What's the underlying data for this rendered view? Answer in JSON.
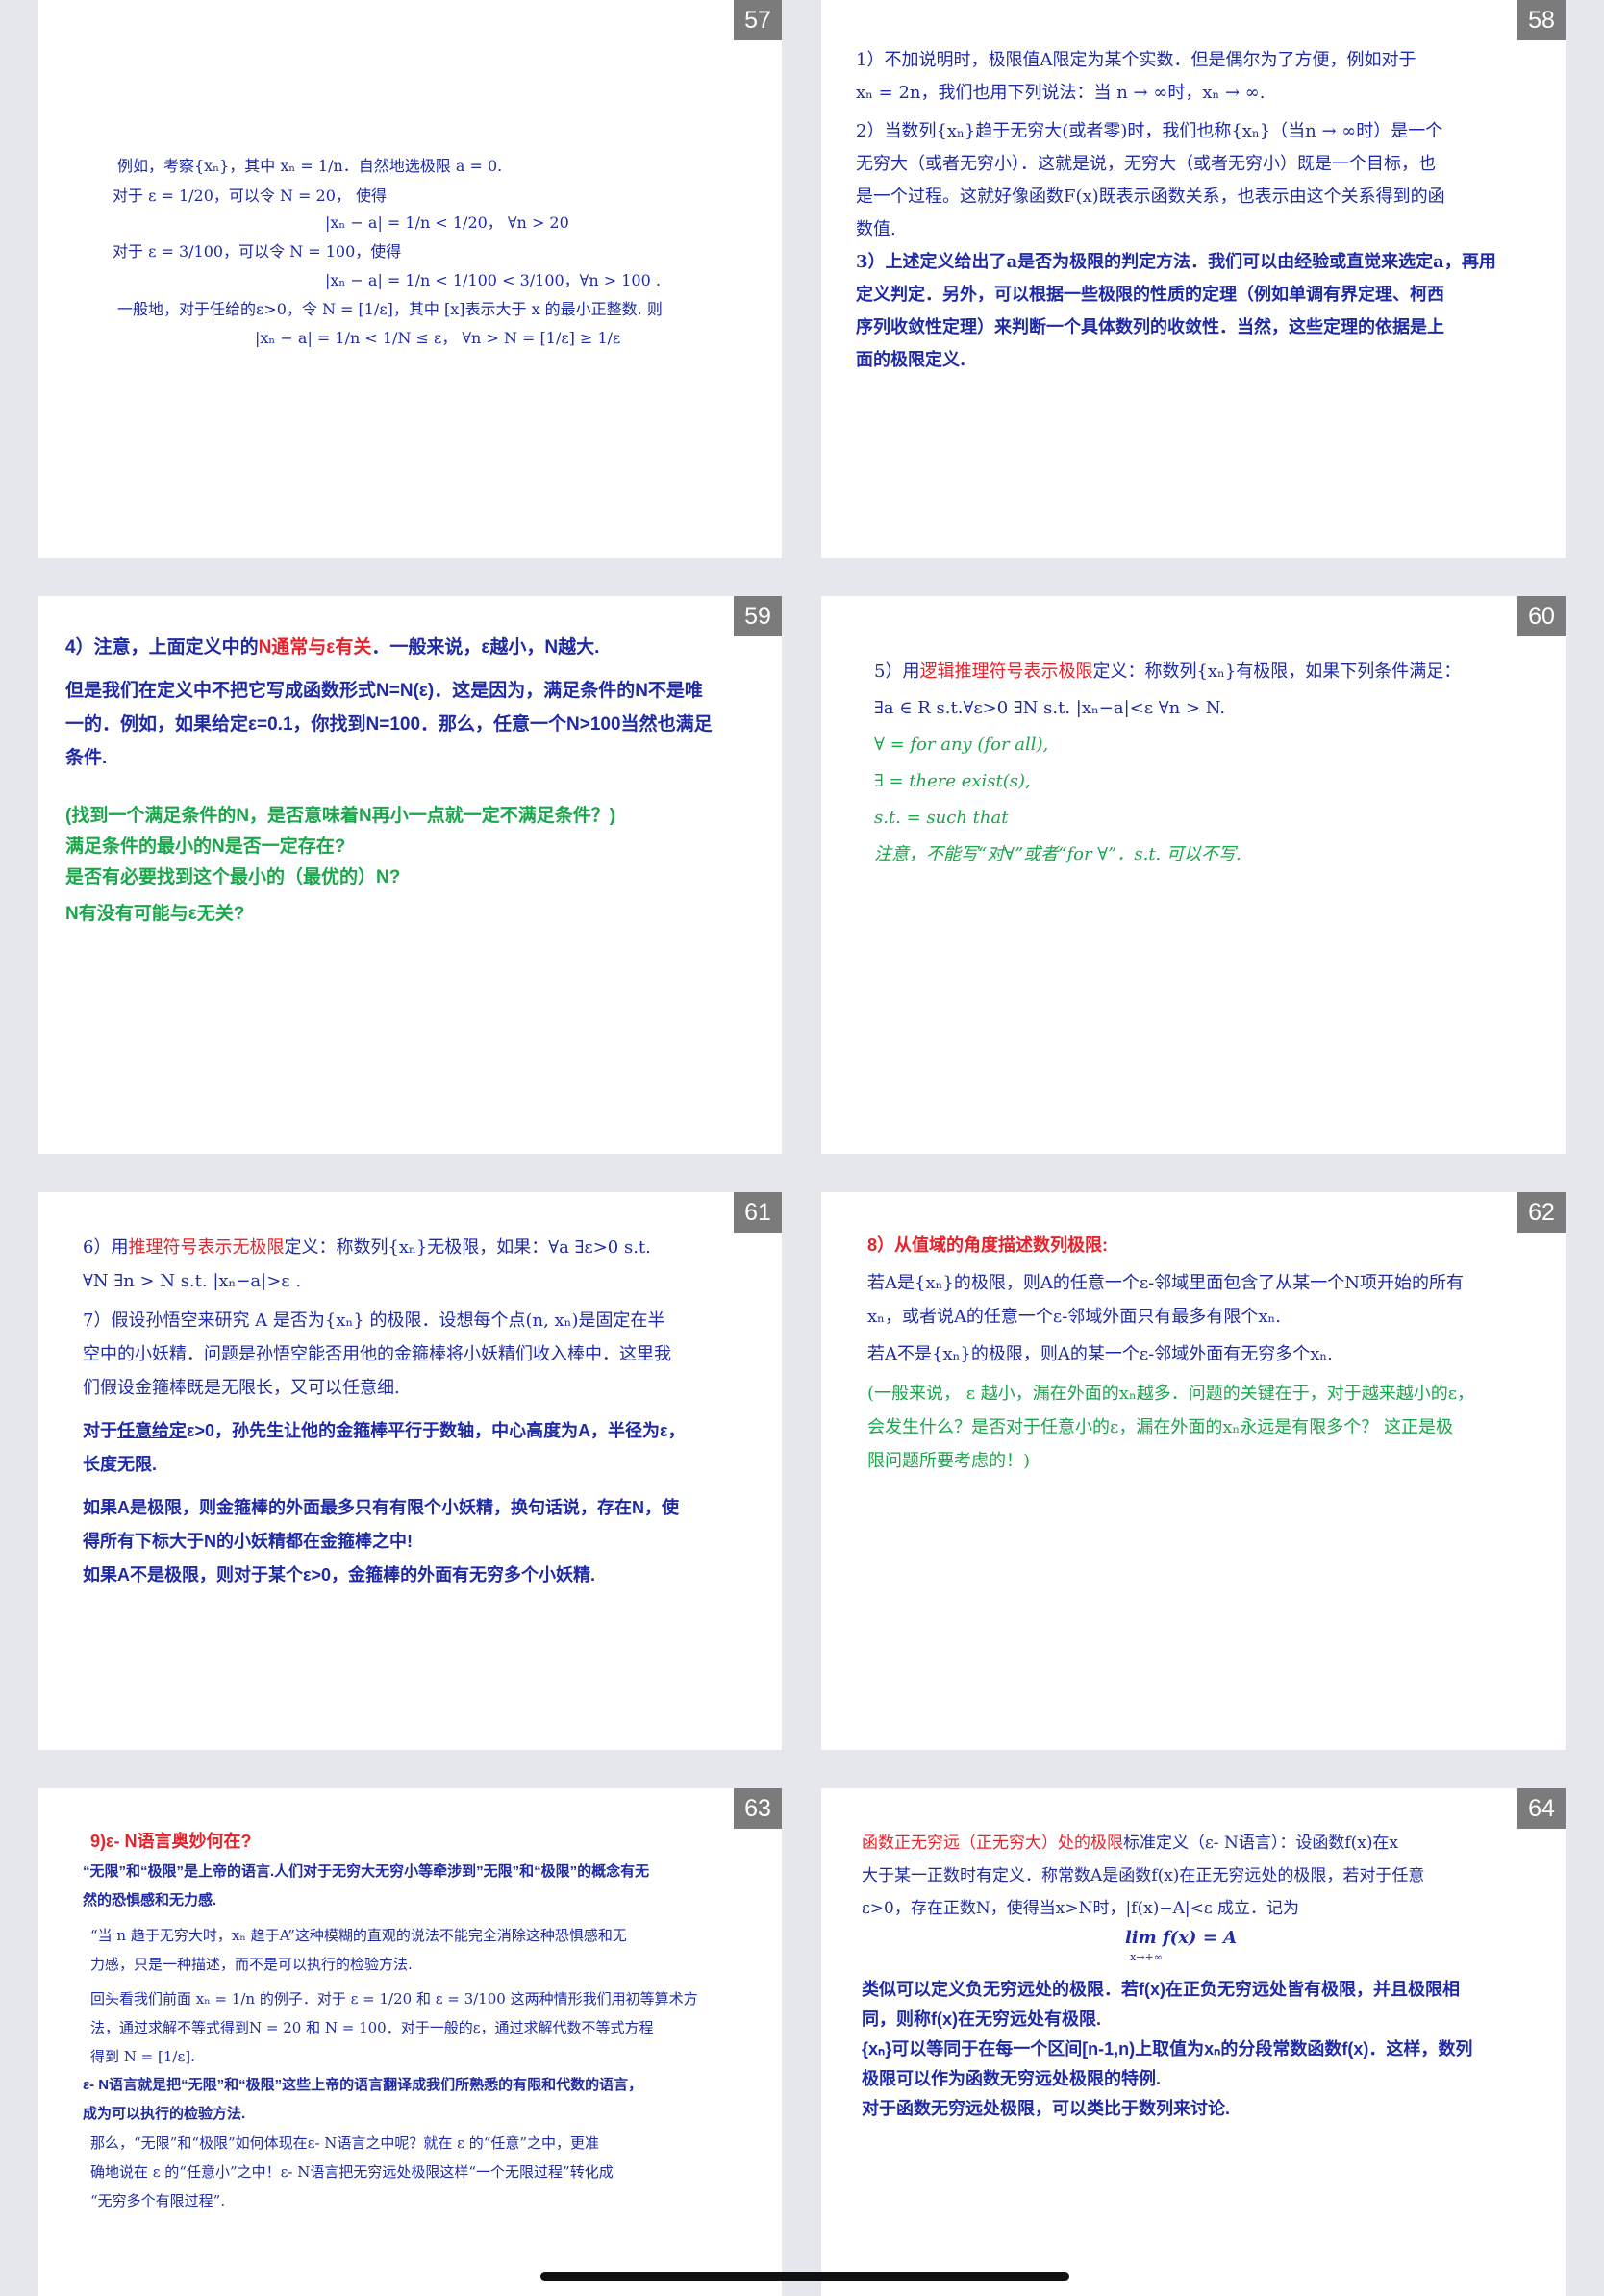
{
  "slides": [
    {
      "num": "57",
      "lines": [
        "例如，考察{xₙ}，其中 xₙ = 1/n．自然地选极限 a = 0.",
        "对于  ε = 1/20，可以令  N = 20，   使得",
        "|xₙ − a| = 1/n < 1/20，      ∀n > 20",
        "对于  ε = 3/100，可以令 N = 100，使得",
        "|xₙ − a| = 1/n < 1/100 < 3/100，∀n > 100 .",
        "一般地，对于任给的ε>0，令 N = [1/ε]，其中 [x]表示大于 x 的最小正整数. 则",
        "|xₙ − a| = 1/n < 1/N ≤ ε，      ∀n > N = [1/ε] ≥ 1/ε"
      ]
    },
    {
      "num": "58",
      "lines": [
        "1）不加说明时，极限值A限定为某个实数．但是偶尔为了方便，例如对于",
        "xₙ = 2n，我们也用下列说法：当  n → ∞时，xₙ → ∞.",
        "2）当数列{xₙ}趋于无穷大(或者零)时，我们也称{xₙ}（当n → ∞时）是一个",
        "无穷大（或者无穷小）．这就是说，无穷大（或者无穷小）既是一个目标，也",
        "是一个过程。这就好像函数F(x)既表示函数关系，也表示由这个关系得到的函",
        "数值.",
        "3）上述定义给出了a是否为极限的判定方法．我们可以由经验或直觉来选定a，再用",
        "定义判定．另外，可以根据一些极限的性质的定理（例如单调有界定理、柯西",
        "序列收敛性定理）来判断一个具体数列的收敛性．当然，这些定理的依据是上",
        "面的极限定义."
      ]
    },
    {
      "num": "59",
      "l1_a": "4）注意，上面定义中的",
      "l1_b": "N通常与ε有关",
      "l1_c": "．一般来说，ε越小，N越大.",
      "lines": [
        "但是我们在定义中不把它写成函数形式N=N(ε)．这是因为，满足条件的N不是唯",
        "一的．例如，如果给定ε=0.1，你找到N=100．那么，任意一个N>100当然也满足",
        "条件."
      ],
      "green": [
        "(找到一个满足条件的N，是否意味着N再小一点就一定不满足条件？)",
        "满足条件的最小的N是否一定存在?",
        "是否有必要找到这个最小的（最优的）N?",
        "N有没有可能与ε无关?"
      ]
    },
    {
      "num": "60",
      "l1_a": "5）用",
      "l1_b": "逻辑推理符号表示极限",
      "l1_c": "定义：称数列{xₙ}有极限，如果下列条件满足：",
      "l2": "∃a ∈ R  s.t.∀ε>0 ∃N s.t.  |xₙ−a|<ε ∀n > N.",
      "green": [
        "∀ = for any  (for all),",
        "∃ = there exist(s),",
        "s.t. = such that",
        "注意，不能写“对∀”或者“for ∀”．s.t. 可以不写."
      ]
    },
    {
      "num": "61",
      "l1_a": "6）用",
      "l1_b": "推理符号表示无极限",
      "l1_c": "定义：称数列{xₙ}无极限，如果：∀a ∃ε>0  s.t.",
      "lines": [
        "∀N ∃n > N  s.t.  |xₙ−a|>ε .",
        "7）假设孙悟空来研究  A  是否为{xₙ} 的极限．设想每个点(n, xₙ)是固定在半",
        "空中的小妖精．问题是孙悟空能否用他的金箍棒将小妖精们收入棒中．这里我",
        "们假设金箍棒既是无限长，又可以任意细."
      ],
      "b1_a": "对于",
      "b1_b": "任意给定",
      "b1_c": "ε>0，孙先生让他的金箍棒平行于数轴，中心高度为A，半径为ε，",
      "b2": "长度无限.",
      "b3": [
        "如果A是极限，则金箍棒的外面最多只有有限个小妖精，换句话说，存在N，使",
        "得所有下标大于N的小妖精都在金箍棒之中!",
        "如果A不是极限，则对于某个ε>0，金箍棒的外面有无穷多个小妖精."
      ]
    },
    {
      "num": "62",
      "title": "8）从值域的角度描述数列极限:",
      "lines": [
        "若A是{xₙ}的极限，则A的任意一个ε-邻域里面包含了从某一个N项开始的所有",
        "xₙ，或者说A的任意一个ε-邻域外面只有最多有限个xₙ.",
        "若A不是{xₙ}的极限，则A的某一个ε-邻域外面有无穷多个xₙ."
      ],
      "green": [
        "(一般来说， ε 越小，漏在外面的xₙ越多．问题的关键在于，对于越来越小的ε，",
        "会发生什么？是否对于任意小的ε，漏在外面的xₙ永远是有限多个？  这正是极",
        "限问题所要考虑的！)"
      ]
    },
    {
      "num": "63",
      "title_a": "9)ε-  ",
      "title_b": "N语言奥妙何在?",
      "intro": [
        "“无限”和“极限”是上帝的语言.人们对于无穷大无穷小等牵涉到”无限”和“极限”的概念有无",
        "然的恐惧感和无力感."
      ],
      "quote": [
        "“当  n  趋于无穷大时，xₙ  趋于A”这种模糊的直观的说法不能完全消除这种恐惧感和无",
        "力感，只是一种描述，而不是可以执行的检验方法."
      ],
      "review": [
        "回头看我们前面 xₙ = 1/n 的例子．对于  ε = 1/20  和  ε = 3/100  这两种情形我们用初等算术方",
        "法，通过求解不等式得到N = 20  和  N = 100．对于一般的ε，通过求解代数不等式方程",
        "得到 N = [1/ε]."
      ],
      "bold": [
        "ε- N语言就是把“无限”和“极限”这些上帝的语言翻译成我们所熟悉的有限和代数的语言，",
        "成为可以执行的检验方法."
      ],
      "end": [
        "那么，“无限”和“极限”如何体现在ε- N语言之中呢？就在 ε 的“任意”之中，更准",
        "确地说在  ε  的“任意小”之中！ε- N语言把无穷远处极限这样“一个无限过程”转化成",
        "“无穷多个有限过程”."
      ]
    },
    {
      "num": "64",
      "l1_a": "函数正无穷远（正无穷大）处的极限",
      "l1_b": "标准定义（ε- N语言）：设函数f(x)在x",
      "lines": [
        "大于某一正数时有定义．称常数A是函数f(x)在正无穷远处的极限，若对于任意",
        "ε>0，存在正数N，使得当x>N时，|f(x)−A|<ε 成立．记为"
      ],
      "formula": "lim  f(x)  =  A",
      "formula_sub": "x→+∞",
      "bold": [
        "类似可以定义负无穷远处的极限．若f(x)在正负无穷远处皆有极限，并且极限相",
        "同，则称f(x)在无穷远处有极限.",
        "{xₙ}可以等同于在每一个区间[n-1,n)上取值为xₙ的分段常数函数f(x)．这样，数列",
        "极限可以作为函数无穷远处极限的特例.",
        "对于函数无穷远处极限，可以类比于数列来讨论."
      ]
    }
  ]
}
